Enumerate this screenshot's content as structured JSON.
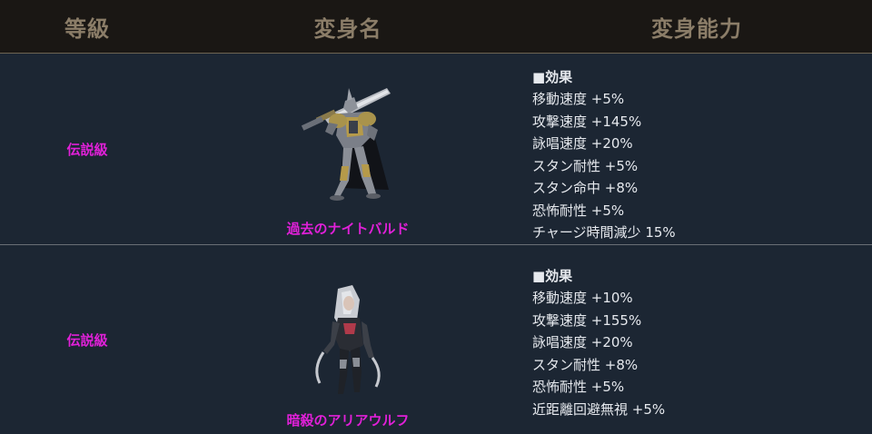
{
  "header": {
    "grade": "等級",
    "name": "変身名",
    "ability": "変身能力"
  },
  "rows": [
    {
      "grade": "伝説級",
      "name": "過去のナイトバルド",
      "figure_icon": "armored-knight-greatsword-icon",
      "effect_title": "■効果",
      "effects": [
        "移動速度 +5%",
        "攻撃速度 +145%",
        "詠唱速度 +20%",
        "スタン耐性 +5%",
        "スタン命中 +8%",
        "恐怖耐性 +5%",
        "チャージ時間減少 15%"
      ]
    },
    {
      "grade": "伝説級",
      "name": "暗殺のアリアウルフ",
      "figure_icon": "assassin-dual-blades-icon",
      "effect_title": "■効果",
      "effects": [
        "移動速度 +10%",
        "攻撃速度 +155%",
        "詠唱速度 +20%",
        "スタン耐性 +8%",
        "恐怖耐性 +5%",
        "近距離回避無視 +5%"
      ]
    }
  ],
  "colors": {
    "grade_text": "#e020d8",
    "header_bg": "#1a1714",
    "header_text": "#8b7d68",
    "body_bg": "#1c2633"
  }
}
